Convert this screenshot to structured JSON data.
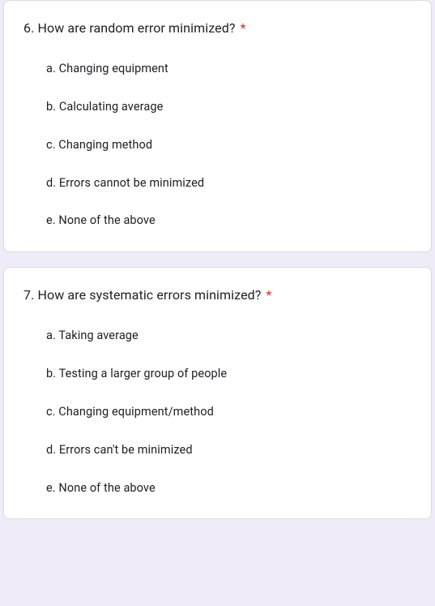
{
  "required_marker": "*",
  "questions": [
    {
      "title": "6. How are random error minimized?",
      "options": [
        "a. Changing equipment",
        "b. Calculating average",
        "c. Changing method",
        "d. Errors cannot be minimized",
        "e. None of the above"
      ]
    },
    {
      "title": "7. How are systematic errors minimized?",
      "options": [
        "a. Taking average",
        "b. Testing a larger group of people",
        "c. Changing equipment/method",
        "d. Errors can't be minimized",
        "e. None of the above"
      ]
    }
  ]
}
